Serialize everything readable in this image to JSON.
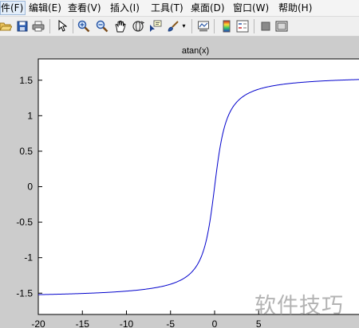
{
  "menubar": {
    "items": [
      "件(F)",
      "编辑(E)",
      "查看(V)",
      "插入(I)",
      "工具(T)",
      "桌面(D)",
      "窗口(W)",
      "帮助(H)"
    ]
  },
  "toolbar": {
    "buttons": [
      "open-folder-icon",
      "save-icon",
      "print-icon",
      "pointer-icon",
      "zoom-in-icon",
      "zoom-out-icon",
      "pan-hand-icon",
      "rotate-3d-icon",
      "data-cursor-icon",
      "brush-icon",
      "dropdown-arrow-icon",
      "link-plot-icon",
      "colorbar-icon",
      "legend-icon",
      "hide-plot-tools-icon",
      "show-plot-tools-icon"
    ]
  },
  "chart_data": {
    "type": "line",
    "title": "atan(x)",
    "xlabel": "",
    "ylabel": "",
    "xlim": [
      -20,
      20
    ],
    "ylim": [
      -1.8,
      1.8
    ],
    "x_ticks": [
      -20,
      -15,
      -10,
      -5,
      0,
      5
    ],
    "y_ticks": [
      1.5,
      1,
      0.5,
      0,
      -0.5,
      -1,
      -1.5
    ],
    "x_tick_labels": [
      "-20",
      "-15",
      "-10",
      "-5",
      "0",
      "5"
    ],
    "y_tick_labels": [
      "1.5",
      "1",
      "0.5",
      "0",
      "-0.5",
      "-1",
      "-1.5"
    ],
    "series": [
      {
        "color": "#0000cc",
        "function": "atan(x)",
        "x": [
          -20,
          -15,
          -10,
          -7,
          -5,
          -4,
          -3,
          -2,
          -1.5,
          -1,
          -0.5,
          0,
          0.5,
          1,
          1.5,
          2,
          3,
          4,
          5,
          7,
          10,
          15,
          20
        ],
        "y": [
          -1.5208,
          -1.5042,
          -1.4711,
          -1.4289,
          -1.3734,
          -1.3258,
          -1.249,
          -1.1071,
          -0.9828,
          -0.7854,
          -0.4636,
          0,
          0.4636,
          0.7854,
          0.9828,
          1.1071,
          1.249,
          1.3258,
          1.3734,
          1.4289,
          1.4711,
          1.5042,
          1.5208
        ]
      }
    ],
    "grid": false,
    "line_color": "#0000cc"
  },
  "watermark": "软件技巧"
}
